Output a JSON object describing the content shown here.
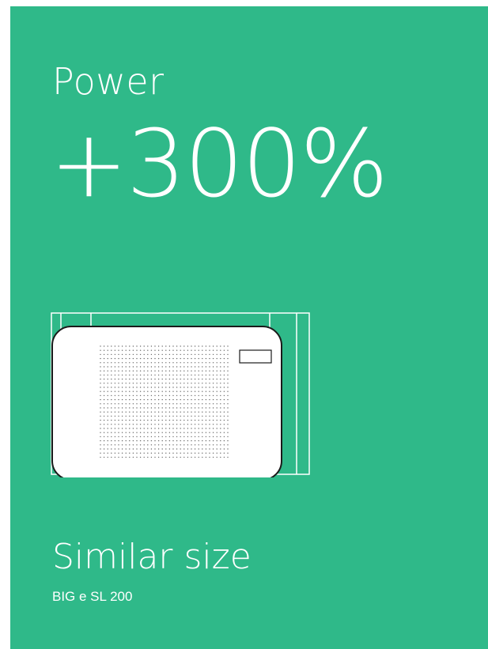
{
  "colors": {
    "background": "#2fb989",
    "text": "#ffffff",
    "device_fill": "#ffffff",
    "device_outline": "#1a1a1a"
  },
  "header": {
    "title": "Power",
    "stat": "+300%"
  },
  "illustration": {
    "icon": "device-comparison-icon"
  },
  "footer": {
    "title": "Similar size",
    "subtitle": "BIG e SL 200"
  }
}
